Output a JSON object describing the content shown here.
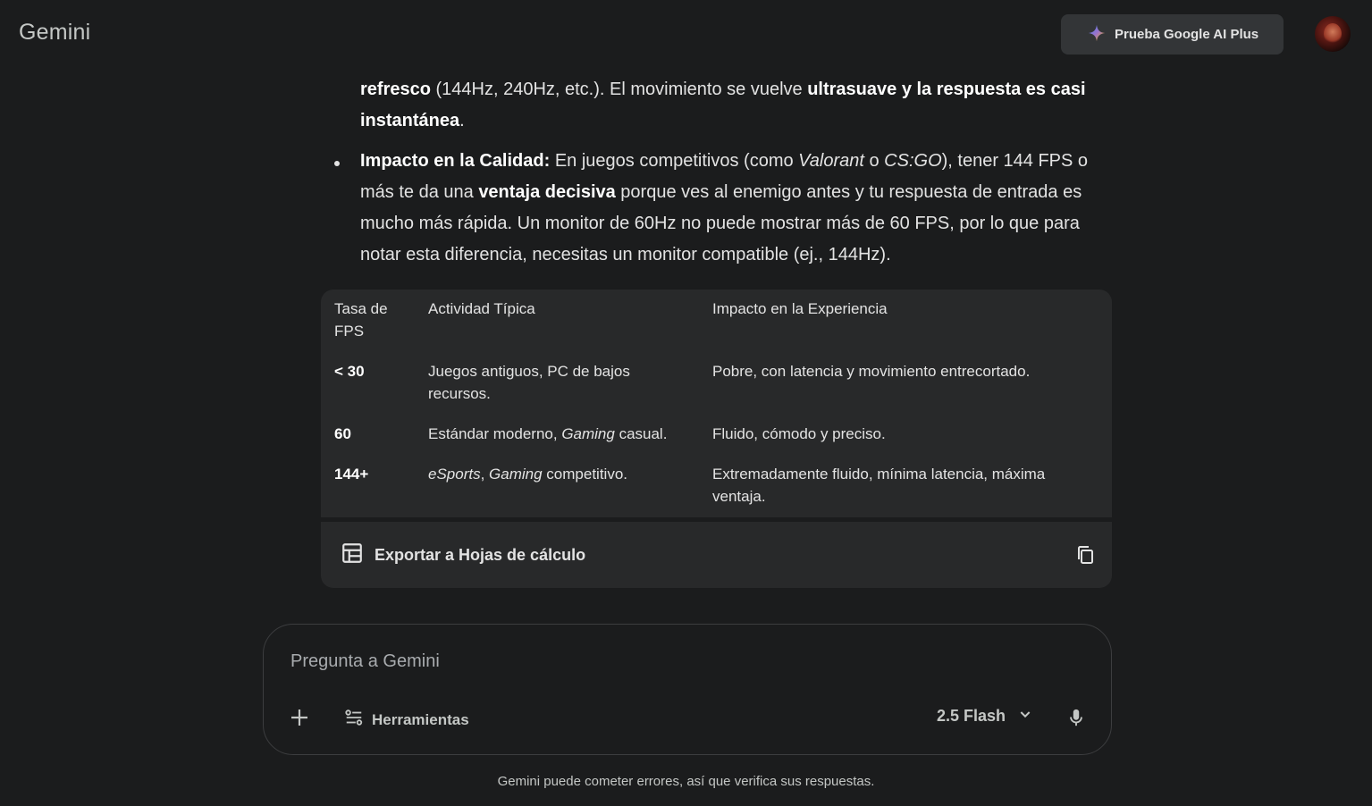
{
  "app": {
    "title": "Gemini"
  },
  "header": {
    "promo_label": "Prueba Google AI Plus"
  },
  "response": {
    "p1_a": "refresco",
    "p1_b": " (144Hz, 240Hz, etc.). El movimiento se vuelve ",
    "p1_c": "ultrasuave y la respuesta es casi instantánea",
    "p1_d": ".",
    "bullet": {
      "lead": "Impacto en la Calidad:",
      "t1": " En juegos competitivos (como ",
      "i1": "Valorant",
      "t2": " o ",
      "i2": "CS:GO",
      "t3": "), tener 144 FPS o más te da una ",
      "b1": "ventaja decisiva",
      "t4": " porque ves al enemigo antes y tu respuesta de entrada es mucho más rápida. Un monitor de 60Hz no puede mostrar más de 60 FPS, por lo que para notar esta diferencia, necesitas un monitor compatible (ej., 144Hz)."
    }
  },
  "table": {
    "headers": [
      "Tasa de FPS",
      "Actividad Típica",
      "Impacto en la Experiencia"
    ],
    "rows": [
      {
        "fps": "< 30",
        "act": "Juegos antiguos, PC de bajos recursos.",
        "impact": "Pobre, con latencia y movimiento entrecortado."
      },
      {
        "fps": "60",
        "act_a": "Estándar moderno, ",
        "act_i": "Gaming",
        "act_b": " casual.",
        "impact": "Fluido, cómodo y preciso."
      },
      {
        "fps": "144+",
        "act_i1": "eSports",
        "act_a": ", ",
        "act_i2": "Gaming",
        "act_b": " competitivo.",
        "impact": "Extremadamente fluido, mínima latencia, máxima ventaja."
      }
    ]
  },
  "export": {
    "label": "Exportar a Hojas de cálculo"
  },
  "composer": {
    "placeholder": "Pregunta a Gemini",
    "tools_label": "Herramientas",
    "model_label": "2.5 Flash"
  },
  "footer": {
    "disclaimer": "Gemini puede cometer errores, así que verifica sus respuestas."
  }
}
